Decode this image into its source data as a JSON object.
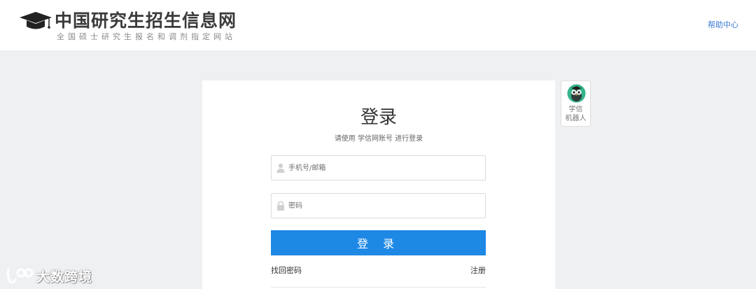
{
  "header": {
    "logo_icon": "graduation-cap-icon",
    "site_title": "中国研究生招生信息网",
    "site_subtitle": "全国硕士研究生报名和调剂指定网站",
    "help_link": "帮助中心"
  },
  "login": {
    "title": "登录",
    "subtitle": "请使用 学信网账号 进行登录",
    "username_placeholder": "手机号/邮箱",
    "username_icon": "user-icon",
    "password_placeholder": "密码",
    "password_icon": "lock-icon",
    "submit_label": "登 录",
    "forgot_password": "找回密码",
    "register": "注册"
  },
  "robot": {
    "icon": "owl-robot-icon",
    "label_line1": "学信",
    "label_line2": "机器人"
  },
  "watermark": {
    "text": "大数跨境"
  },
  "colors": {
    "accent": "#1e88e5",
    "link": "#3a7bd5",
    "page_bg": "#eff0f2"
  }
}
